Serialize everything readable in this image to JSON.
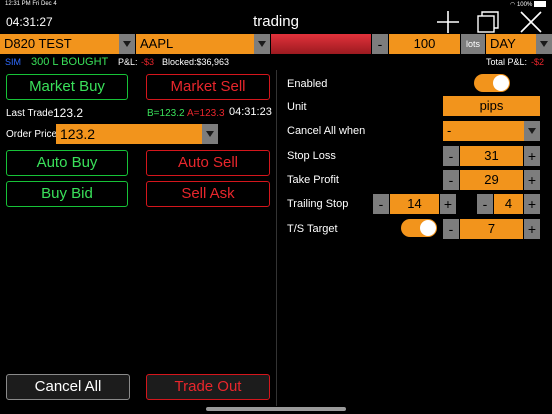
{
  "status": {
    "time_date": "12:31 PM  Fri Dec 4",
    "battery": "100%"
  },
  "header": {
    "clock": "04:31:27",
    "title": "trading"
  },
  "top_bar": {
    "account": "D820 TEST",
    "symbol": "AAPL",
    "quantity": "100",
    "unit_label": "lots",
    "tif": "DAY",
    "minus": "-",
    "plus": "+"
  },
  "info_bar": {
    "sim": "SIM",
    "position": "300 L BOUGHT",
    "pl_label": "P&L:",
    "pl_value": "-$3",
    "blocked": "Blocked:$36,963",
    "total_label": "Total P&L:",
    "total_value": "-$2"
  },
  "left": {
    "market_buy": "Market Buy",
    "market_sell": "Market Sell",
    "last_trade_label": "Last Trade",
    "last_trade_value": "123.2",
    "bid": "B=123.2",
    "ask": "A=123.3",
    "quote_time": "04:31:23",
    "order_price_label": "Order Price",
    "order_price_value": "123.2",
    "auto_buy": "Auto Buy",
    "auto_sell": "Auto Sell",
    "buy_bid": "Buy Bid",
    "sell_ask": "Sell Ask",
    "cancel_all": "Cancel All",
    "trade_out": "Trade Out"
  },
  "right": {
    "enabled_label": "Enabled",
    "enabled": true,
    "unit_label": "Unit",
    "unit_value": "pips",
    "cancel_all_when_label": "Cancel All when",
    "cancel_all_when_value": "-",
    "stop_loss_label": "Stop Loss",
    "stop_loss_value": "31",
    "take_profit_label": "Take Profit",
    "take_profit_value": "29",
    "trailing_stop_label": "Trailing Stop",
    "trailing_stop_value": "14",
    "trailing_step_value": "4",
    "ts_target_label": "T/S Target",
    "ts_target_value": "7",
    "ts_target_enabled": true
  },
  "colors": {
    "accent": "#f2941c",
    "buy": "#3ae05a",
    "sell": "#e8262c",
    "link": "#2f6bff"
  }
}
